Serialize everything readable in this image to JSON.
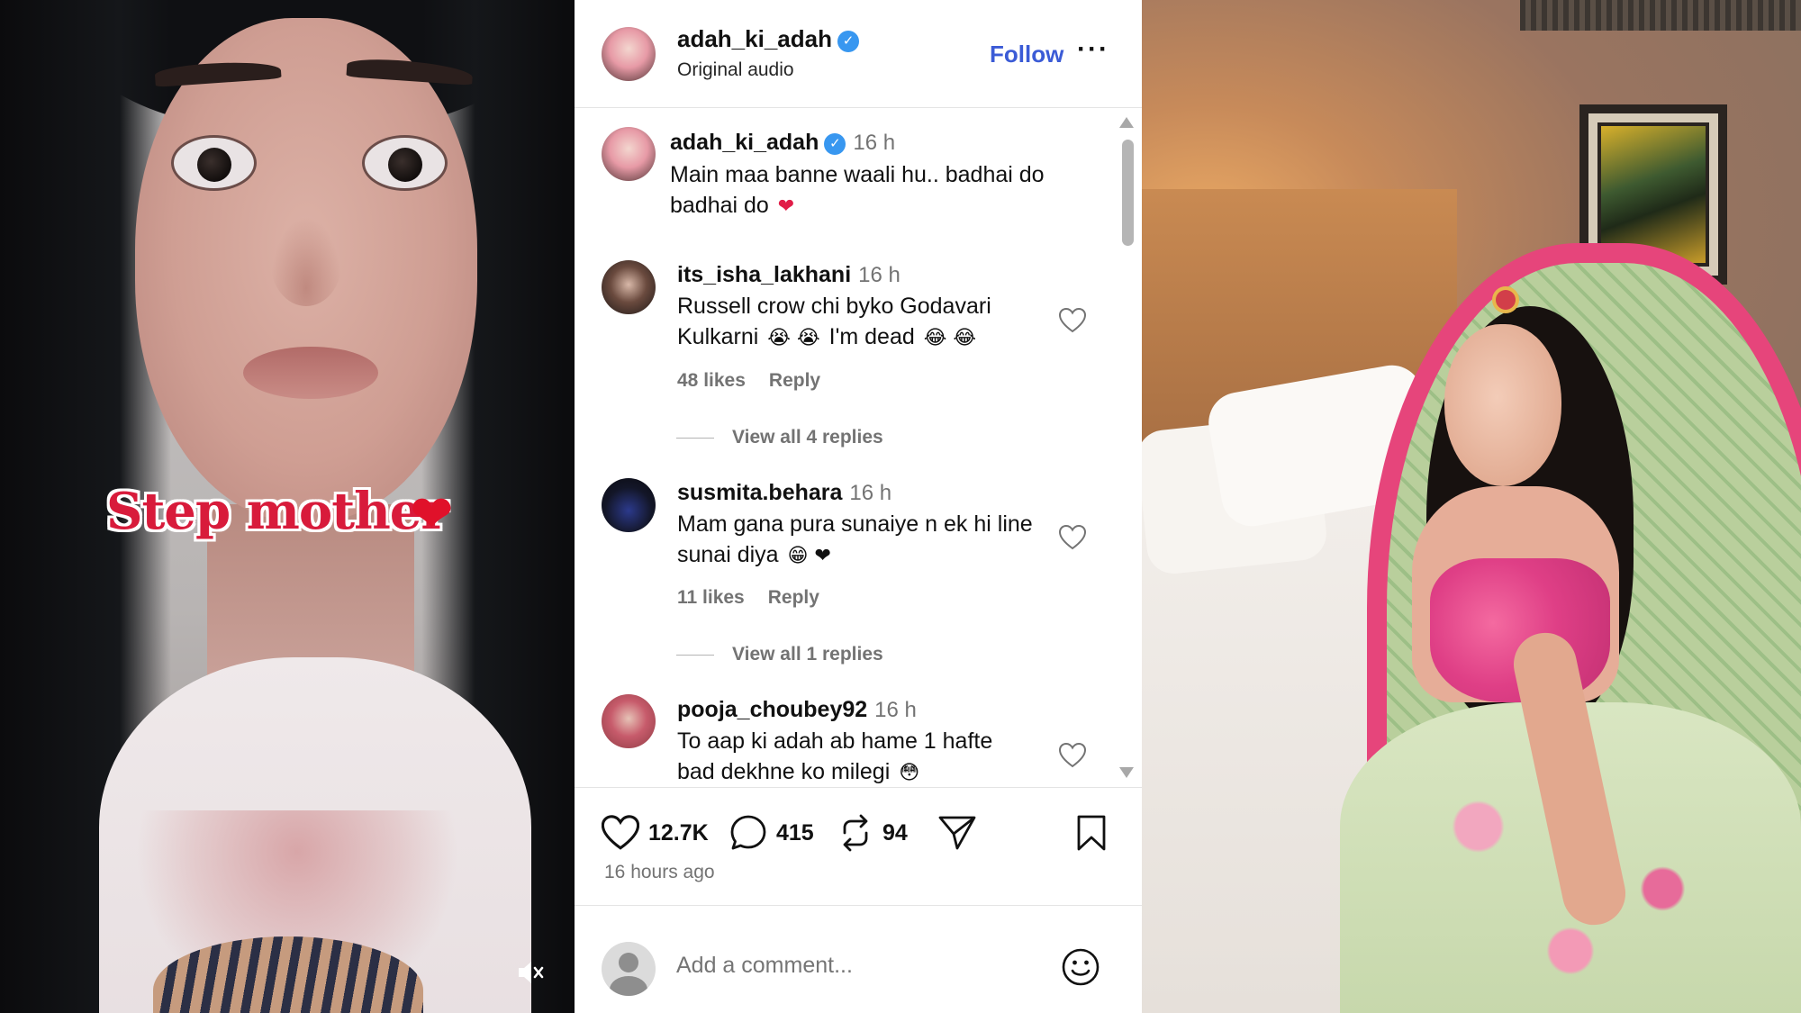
{
  "left_photo": {
    "sticker_text": "Step mother",
    "sticker_emoji": "❤",
    "mute_icon": "speaker-muted-icon"
  },
  "post": {
    "header": {
      "username": "adah_ki_adah",
      "subtitle": "Original audio",
      "follow_label": "Follow",
      "more_label": "···"
    },
    "caption": {
      "username": "adah_ki_adah",
      "time": "16 h",
      "line1": "Main maa banne waali hu.. badhai do",
      "line2": "badhai do",
      "emoji": "❤"
    },
    "comments": [
      {
        "username": "its_isha_lakhani",
        "time": "16 h",
        "line1": "Russell crow chi byko Godavari",
        "line2_text": "Kulkarni",
        "line2_emoji_a": "😭 😭",
        "line2_text2": "I'm dead",
        "line2_emoji_b": "😂 😂",
        "likes": "48 likes",
        "reply": "Reply",
        "view_replies": "View all 4 replies"
      },
      {
        "username": "susmita.behara",
        "time": "16 h",
        "line1": "Mam gana pura sunaiye n ek hi line",
        "line2_text": "sunai diya",
        "line2_emoji": "😁 ❤",
        "likes": "11 likes",
        "reply": "Reply",
        "view_replies": "View all 1 replies"
      },
      {
        "username": "pooja_choubey92",
        "time": "16 h",
        "line1": "To aap ki adah ab hame 1 hafte",
        "line2_text": "bad dekhne ko milegi",
        "line2_emoji": "😳"
      }
    ],
    "actions": {
      "likes": "12.7K",
      "comments": "415",
      "reposts": "94"
    },
    "time_ago": "16 hours ago",
    "add_comment_placeholder": "Add a comment...",
    "accent_color": "#3b5bd6",
    "like_color": "#e11d48"
  }
}
